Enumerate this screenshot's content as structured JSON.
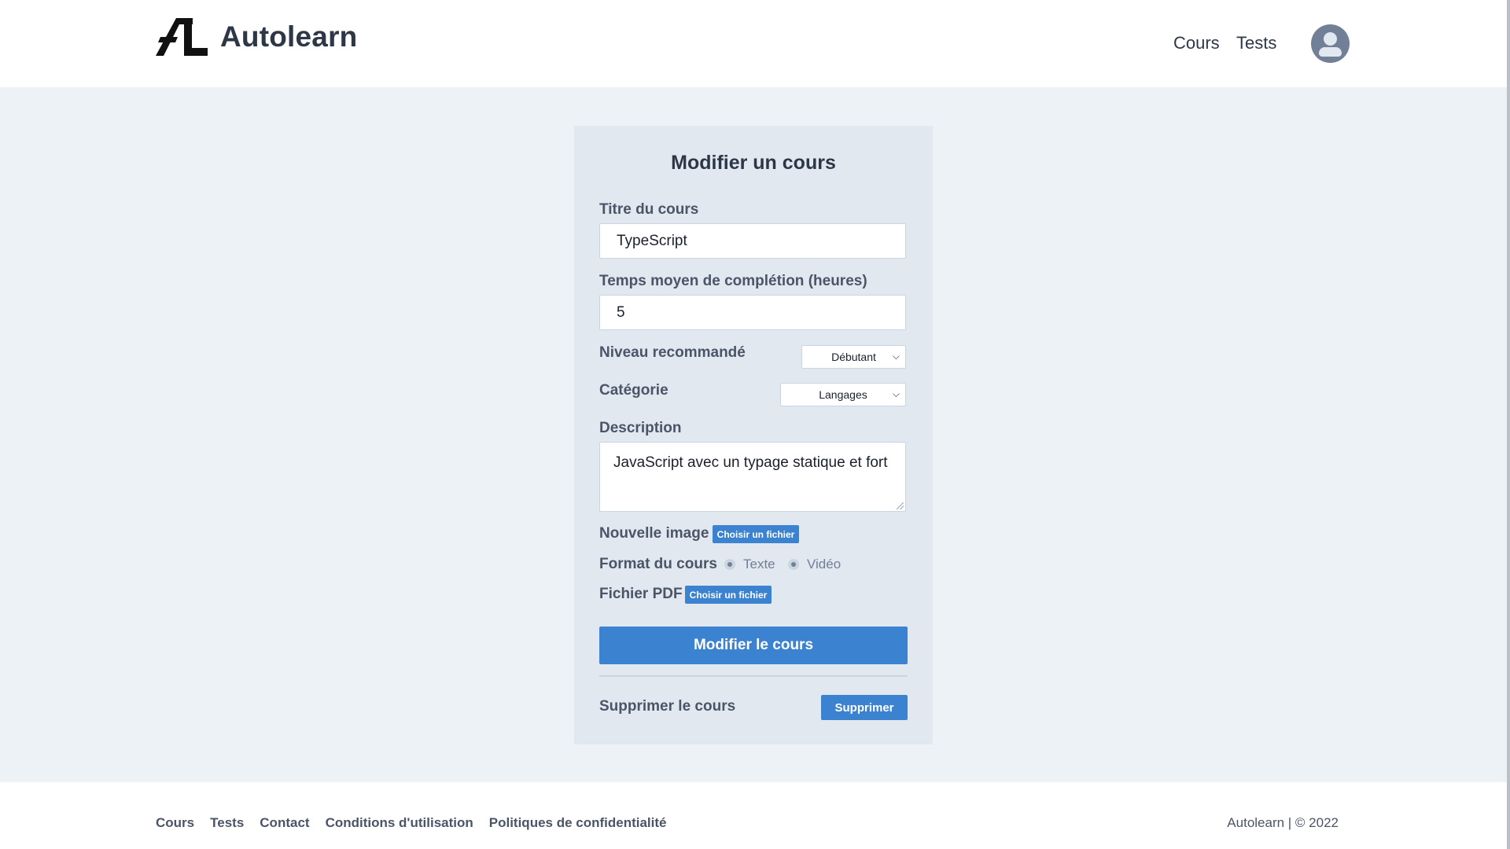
{
  "brand": {
    "name": "Autolearn"
  },
  "nav": {
    "courses": "Cours",
    "tests": "Tests"
  },
  "form": {
    "title": "Modifier un cours",
    "course_title_label": "Titre du cours",
    "course_title_value": "TypeScript",
    "avg_time_label": "Temps moyen de complétion (heures)",
    "avg_time_value": "5",
    "level_label": "Niveau recommandé",
    "level_value": "Débutant",
    "category_label": "Catégorie",
    "category_value": "Langages",
    "description_label": "Description",
    "description_value": "JavaScript avec un typage statique et fort",
    "new_image_label": "Nouvelle image",
    "choose_file_label": "Choisir un fichier",
    "format_label": "Format du cours",
    "format_options": [
      "Texte",
      "Vidéo"
    ],
    "pdf_label": "Fichier PDF",
    "submit_label": "Modifier le cours",
    "delete_section_label": "Supprimer le cours",
    "delete_button_label": "Supprimer"
  },
  "footer": {
    "links": [
      "Cours",
      "Tests",
      "Contact",
      "Conditions d'utilisation",
      "Politiques de confidentialité"
    ],
    "copyright": "Autolearn | © 2022"
  },
  "colors": {
    "accent": "#3b82d0",
    "page_bg": "#edf2f7",
    "card_bg": "#e2e8f0",
    "text": "#2d3748"
  }
}
